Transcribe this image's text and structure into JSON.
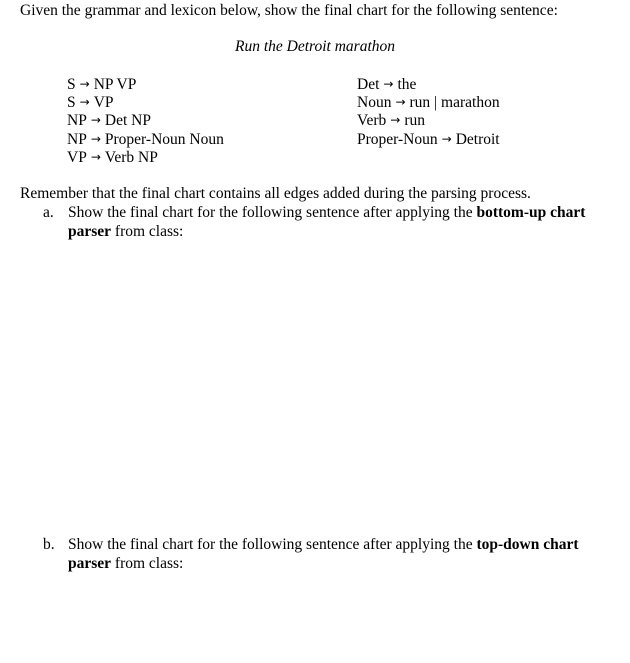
{
  "intro": "Given the grammar and lexicon below, show the final chart for the following sentence:",
  "sentence": "Run the Detroit marathon",
  "arrow_glyph": "→",
  "grammar": [
    {
      "lhs": "S",
      "rhs": "NP VP"
    },
    {
      "lhs": "S",
      "rhs": "VP"
    },
    {
      "lhs": "NP",
      "rhs": "Det NP"
    },
    {
      "lhs": "NP",
      "rhs": "Proper-Noun Noun"
    },
    {
      "lhs": "VP",
      "rhs": "Verb NP"
    }
  ],
  "lexicon": [
    {
      "lhs": "Det",
      "rhs": "the"
    },
    {
      "lhs": "Noun",
      "rhs": "run | marathon"
    },
    {
      "lhs": "Verb",
      "rhs": "run"
    },
    {
      "lhs": "Proper-Noun",
      "rhs": "Detroit"
    }
  ],
  "remember": "Remember that the final chart contains all edges added during the parsing process.",
  "questions": [
    {
      "letter": "a.",
      "text_before": "Show the final chart for the following sentence after applying the ",
      "bold_line1": "bottom-up chart",
      "bold_line2": "parser",
      "text_after": " from class:"
    },
    {
      "letter": "b.",
      "text_before": "Show the final chart for the following sentence after applying the ",
      "bold_line1": "top-down chart",
      "bold_line2": "parser",
      "text_after": " from class:"
    }
  ]
}
